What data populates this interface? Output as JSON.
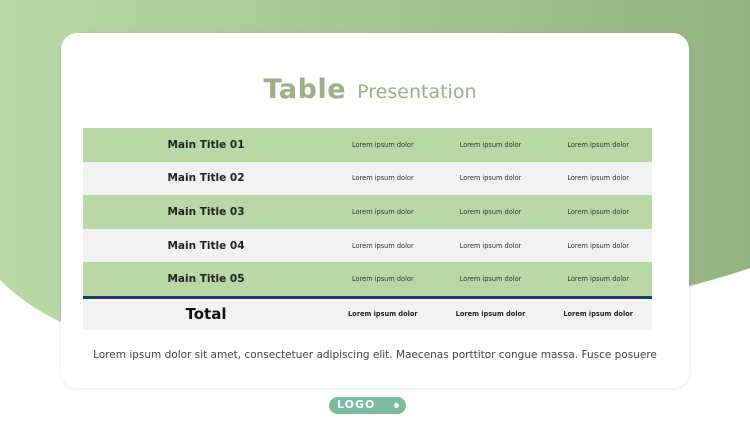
{
  "colors": {
    "green_row": "#b9d8a6",
    "grey_row": "#f2f2f2",
    "title": "#9caf88",
    "total_border": "#1f3d68",
    "logo_pill": "#7dbb9e"
  },
  "header": {
    "title": "Table",
    "subtitle": "Presentation"
  },
  "table": {
    "rows": [
      {
        "title": "Main Title 01",
        "cells": [
          "Lorem ipsum dolor",
          "Lorem ipsum dolor",
          "Lorem ipsum dolor"
        ]
      },
      {
        "title": "Main Title 02",
        "cells": [
          "Lorem ipsum dolor",
          "Lorem ipsum dolor",
          "Lorem ipsum dolor"
        ]
      },
      {
        "title": "Main Title 03",
        "cells": [
          "Lorem ipsum dolor",
          "Lorem ipsum dolor",
          "Lorem ipsum dolor"
        ]
      },
      {
        "title": "Main Title 04",
        "cells": [
          "Lorem ipsum dolor",
          "Lorem ipsum dolor",
          "Lorem ipsum dolor"
        ]
      },
      {
        "title": "Main Title 05",
        "cells": [
          "Lorem ipsum dolor",
          "Lorem ipsum dolor",
          "Lorem ipsum dolor"
        ]
      }
    ],
    "total": {
      "title": "Total",
      "cells": [
        "Lorem ipsum dolor",
        "Lorem ipsum dolor",
        "Lorem ipsum dolor"
      ]
    }
  },
  "footer": {
    "text": "Lorem ipsum dolor sit amet, consectetuer adipiscing elit. Maecenas porttitor congue massa. Fusce posuere"
  },
  "logo": {
    "label": "LOGO"
  }
}
